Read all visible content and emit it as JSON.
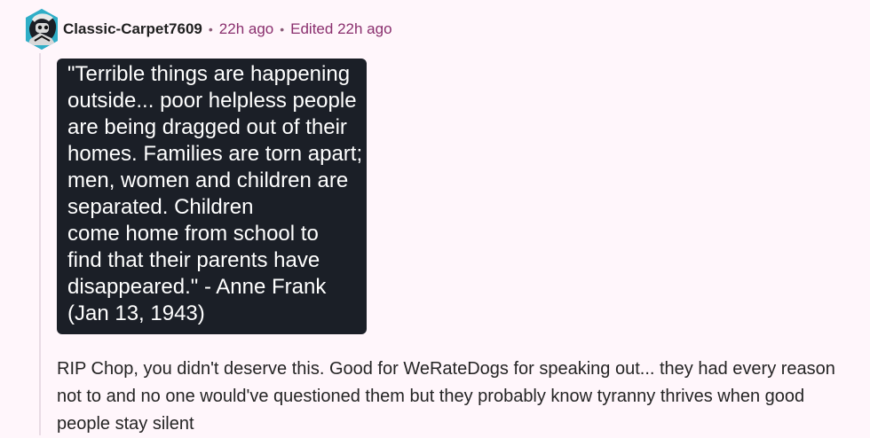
{
  "comment": {
    "username": "Classic-Carpet7609",
    "separator": "•",
    "time": "22h ago",
    "edited": "Edited 22h ago",
    "avatar_icon": "robot-avatar-icon",
    "quote_lines": [
      "\"Terrible things are happening",
      "outside... poor helpless people",
      "are being dragged out of their",
      "homes. Families are torn apart;",
      "men, women and children are",
      "separated. Children",
      "come home from school to",
      "find that their parents have",
      "disappeared.\" - Anne Frank",
      "(Jan 13, 1943)"
    ],
    "body_text": "RIP Chop, you didn't deserve this. Good for WeRateDogs for speaking out... they had every reason not to and no one would've questioned them but they probably know tyranny thrives when good people stay silent"
  },
  "colors": {
    "page_background": "#fff6fb",
    "username": "#1f1f1f",
    "meta": "#8a2f6e",
    "quote_background": "#1b1f27",
    "quote_text": "#ffffff",
    "body_text": "#242424",
    "thread_line": "#e8dbe4"
  }
}
